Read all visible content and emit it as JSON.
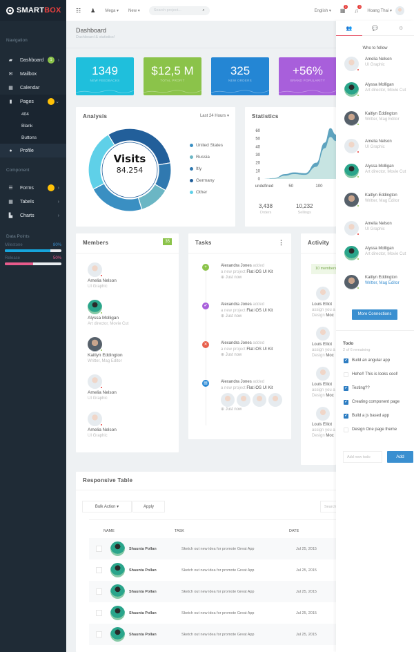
{
  "brand": {
    "name_part1": "SMART",
    "name_part2": "BOX"
  },
  "topbar": {
    "menu_mega": "Mega ▾",
    "menu_new": "New ▾",
    "search_placeholder": "Search project...",
    "language": "English ▾",
    "calendar_badge": "3",
    "bell_badge": "3",
    "user_name": "Hoang Thai ▾"
  },
  "sidebar": {
    "nav_heading": "Navigation",
    "items": [
      {
        "label": "Dashboard",
        "icon": "dashboard-icon",
        "badge": "1",
        "badge_color": "#8bc34a"
      },
      {
        "label": "Mailbox",
        "icon": "mail-icon"
      },
      {
        "label": "Calendar",
        "icon": "calendar-icon"
      },
      {
        "label": "Pages",
        "icon": "file-icon",
        "badge_color": "#ffc107"
      }
    ],
    "sub_items": [
      "404",
      "Blank",
      "Buttons"
    ],
    "profile_label": "Profile",
    "component_heading": "Component",
    "component_items": [
      {
        "label": "Forms",
        "icon": "forms-icon",
        "badge_color": "#ffc107"
      },
      {
        "label": "Tabels",
        "icon": "table-icon"
      },
      {
        "label": "Charts",
        "icon": "chart-icon"
      }
    ],
    "data_points_heading": "Data Points",
    "data_points": [
      {
        "label": "Milestone",
        "value": "80%",
        "fraction": 0.8,
        "color": "#16a5dc",
        "value_color": "#3a8fd0"
      },
      {
        "label": "Release",
        "value": "50%",
        "fraction": 0.5,
        "color": "#e85b8c",
        "value_color": "#e85b8c"
      }
    ]
  },
  "page": {
    "title": "Dashboard",
    "subtitle": "Dashboard & statistics!"
  },
  "stats": [
    {
      "value": "1349",
      "label": "NEW FEEDBACKS",
      "color": "#1fbfdc"
    },
    {
      "value": "$12,5 M",
      "label": "TOTAL PROFIT",
      "color": "#8bc34a"
    },
    {
      "value": "325",
      "label": "NEW ORDERS",
      "color": "#2486d4"
    },
    {
      "value": "+56%",
      "label": "BRAND POPULARITY",
      "color": "#a85fdb"
    }
  ],
  "analysis": {
    "title": "Analysis",
    "range": "Last 24 Hours ▾",
    "center_title": "Visits",
    "center_value": "84.254",
    "legend": [
      {
        "label": "United States",
        "color": "#3a8fc2"
      },
      {
        "label": "Russia",
        "color": "#6bb6c4"
      },
      {
        "label": "Itly",
        "color": "#3079b0"
      },
      {
        "label": "Germany",
        "color": "#225f9a"
      },
      {
        "label": "Other",
        "color": "#5fd0e8"
      }
    ]
  },
  "chart_data": {
    "type": "pie",
    "title": "Analysis",
    "subtitle": "Visits 84.254",
    "categories": [
      "Germany",
      "United States",
      "Russia",
      "Itly",
      "Other"
    ],
    "values": [
      31,
      11,
      12,
      22,
      24
    ],
    "colors": [
      "#225f9a",
      "#3079b0",
      "#6bb6c4",
      "#3a8fc2",
      "#5fd0e8"
    ],
    "legend": "right"
  },
  "statistics": {
    "title": "Statistics",
    "y_ticks": [
      "60",
      "50",
      "40",
      "30",
      "20",
      "10",
      "0"
    ],
    "x_ticks": [
      "undefined",
      "50",
      "100"
    ],
    "ylim": [
      0,
      60
    ],
    "xlim": [
      0,
      140
    ],
    "series_outer": [
      [
        0,
        0
      ],
      [
        20,
        1
      ],
      [
        40,
        6
      ],
      [
        55,
        8
      ],
      [
        75,
        7
      ],
      [
        95,
        20
      ],
      [
        110,
        45
      ],
      [
        120,
        63
      ],
      [
        130,
        55
      ],
      [
        140,
        35
      ]
    ],
    "series_inner": [
      [
        0,
        0
      ],
      [
        20,
        0.5
      ],
      [
        40,
        4
      ],
      [
        55,
        6
      ],
      [
        75,
        5
      ],
      [
        95,
        15
      ],
      [
        110,
        38
      ],
      [
        120,
        52
      ],
      [
        130,
        47
      ],
      [
        140,
        30
      ]
    ],
    "summary": [
      {
        "value": "3,438",
        "label": "Orders"
      },
      {
        "value": "10,232",
        "label": "Sellings"
      }
    ]
  },
  "members": {
    "title": "Members",
    "count": "35",
    "list": [
      {
        "name": "Amelia Nelson",
        "role": "UI Graphic",
        "status": "#e53935",
        "avatar": "face"
      },
      {
        "name": "Alyssa Molligan",
        "role": "Art director, Movie Cut",
        "status": "#8bc34a",
        "avatar": "green"
      },
      {
        "name": "Kaitlyn Eddington",
        "role": "Writter, Mag Editor",
        "status": "#8bc34a",
        "avatar": "dark"
      },
      {
        "name": "Amelia Nelson",
        "role": "UI Graphic",
        "status": "#e53935",
        "avatar": "face"
      },
      {
        "name": "Amelia Nelson",
        "role": "UI Graphic",
        "status": "#e53935",
        "avatar": "face"
      }
    ]
  },
  "tasks": {
    "title": "Tasks",
    "list": [
      {
        "user": "Alexandra Jones",
        "action": "added",
        "mid": "a new project",
        "project": "Flat iOS UI Kit",
        "time": "Just now",
        "color": "#8bc34a",
        "glyph": "+"
      },
      {
        "user": "Alexandra Jones",
        "action": "added",
        "mid": "a new project",
        "project": "Flat iOS UI Kit",
        "time": "Just now",
        "color": "#a85fdb",
        "glyph": "✔"
      },
      {
        "user": "Alexandra Jones",
        "action": "added",
        "mid": "a new project",
        "project": "Flat iOS UI Kit",
        "time": "Just now",
        "color": "#e8604c",
        "glyph": "✕"
      },
      {
        "user": "Alexandra Jones",
        "action": "added",
        "mid": "a new project",
        "project": "Flat iOS UI Kit",
        "time": "Just now",
        "color": "#2486d4",
        "glyph": "▤"
      }
    ]
  },
  "activity": {
    "title": "Activity",
    "badge": "10 members",
    "list": [
      {
        "name": "Louis Elliot",
        "line1": "assign you a",
        "line2a": "Design",
        "line2b": "Moc"
      },
      {
        "name": "Louis Elliot",
        "line1": "assign you a",
        "line2a": "Design",
        "line2b": "Moc"
      },
      {
        "name": "Louis Elliot",
        "line1": "assign you a",
        "line2a": "Design",
        "line2b": "Moc"
      },
      {
        "name": "Louis Elliot",
        "line1": "assign you a",
        "line2a": "Design",
        "line2b": "Moc"
      }
    ]
  },
  "right_panel": {
    "follow_heading": "Who to follow",
    "follow": [
      {
        "name": "Amelia Nelson",
        "role": "UI Graphic",
        "status": "#e53935",
        "avatar": "face"
      },
      {
        "name": "Alyssa Molligan",
        "role": "Art director, Movie Cut",
        "status": "#8bc34a",
        "avatar": "green"
      },
      {
        "name": "Kaitlyn Eddington",
        "role": "Writter, Mag Editor",
        "status": "#8bc34a",
        "avatar": "dark"
      },
      {
        "name": "Amelia Nelson",
        "role": "UI Graphic",
        "status": "#e53935",
        "avatar": "face"
      },
      {
        "name": "Alyssa Molligan",
        "role": "Art director, Movie Cut",
        "status": "#8bc34a",
        "avatar": "green"
      },
      {
        "name": "Kaitlyn Eddington",
        "role": "Writter, Mag Editor",
        "status": "#8bc34a",
        "avatar": "dark"
      },
      {
        "name": "Amelia Nelson",
        "role": "UI Graphic",
        "status": "#e53935",
        "avatar": "face"
      },
      {
        "name": "Alyssa Molligan",
        "role": "Art director, Movie Cut",
        "status": "#8bc34a",
        "avatar": "green"
      },
      {
        "name": "Kaitlyn Eddington",
        "role": "Writter, Mag Editor",
        "status": "#8bc34a",
        "avatar": "dark",
        "link": true
      }
    ],
    "more_button": "More Connections",
    "todo_title": "Todo",
    "todo_remaining": "2 of 6 remaining",
    "todos": [
      {
        "label": "Build an angular app",
        "done": true
      },
      {
        "label": "Hehe!! This is looks cool!",
        "done": false
      },
      {
        "label": "Testing??",
        "done": true
      },
      {
        "label": "Creating component page",
        "done": true
      },
      {
        "label": "Build a js based app",
        "done": true
      },
      {
        "label": "Design One page theme",
        "done": false
      }
    ],
    "todo_placeholder": "Add new todo",
    "add_button": "Add"
  },
  "table": {
    "title": "Responsive Table",
    "bulk_action": "Bulk Action ▾",
    "apply": "Apply",
    "search_placeholder": "Search",
    "headers": [
      "NAME",
      "TASK",
      "DATE"
    ],
    "rows": [
      {
        "name": "Shaunta Pollan",
        "task": "Sketch out new idea for promote Great App",
        "date": "Jul 25, 2015",
        "badge": "#3a8fd0"
      },
      {
        "name": "Shaunta Pollan",
        "task": "Sketch out new idea for promote Great App",
        "date": "Jul 25, 2015",
        "badge": "#ffc107"
      },
      {
        "name": "Shaunta Pollan",
        "task": "Sketch out new idea for promote Great App",
        "date": "Jul 25, 2015",
        "badge": "#5cb85c"
      },
      {
        "name": "Shaunta Pollan",
        "task": "Sketch out new idea for promote Great App",
        "date": "Jul 25, 2015",
        "badge": "#e84c8b"
      },
      {
        "name": "Shaunta Pollan",
        "task": "Sketch out new idea for promote Great App",
        "date": "Jul 25, 2015",
        "badge": "#e8604c"
      }
    ]
  }
}
